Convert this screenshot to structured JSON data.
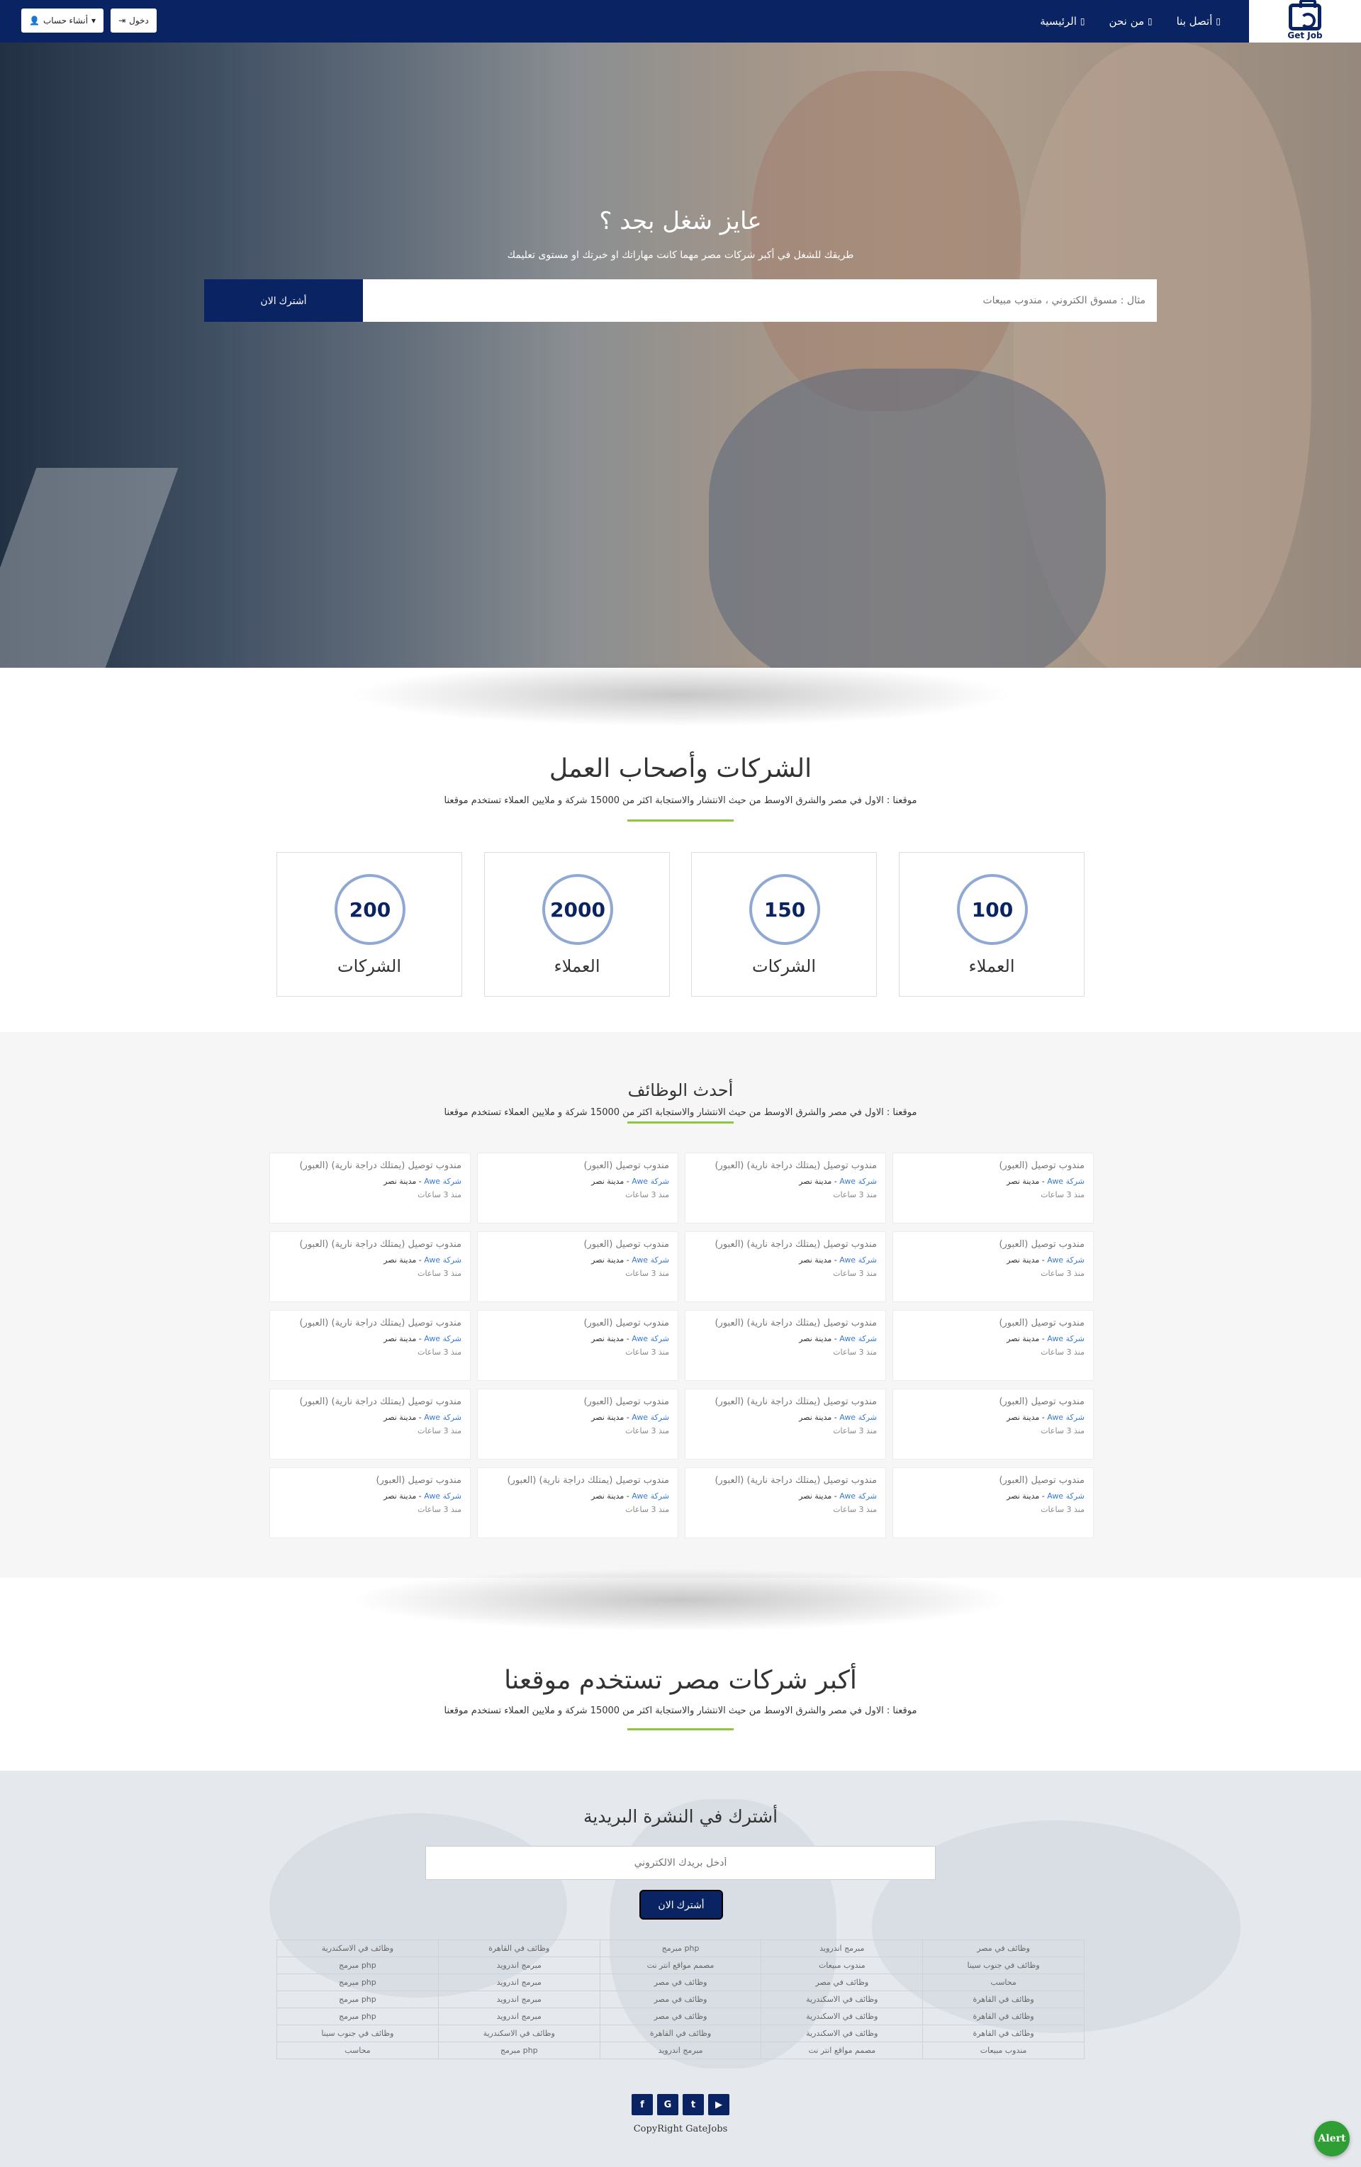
{
  "nav": {
    "logo_text": "Get Job",
    "links": [
      "الرئيسية",
      "من نحن",
      "أتصل بنا"
    ],
    "login": "دخول",
    "register": "أنشاء حساب"
  },
  "hero": {
    "title": "عايز شغل بجد ؟",
    "subtitle": "طريقك للشغل في أكبر شركات مصر مهما كانت مهاراتك او خبرتك او مستوى تعليمك",
    "search_placeholder": "مثال : مسوق الكتروني ، مندوب مبيعات",
    "search_button": "أشترك الان"
  },
  "companies": {
    "title": "الشركات وأصحاب العمل",
    "subtitle": "موقعنا : الاول في مصر والشرق الاوسط من حيث الانتشار والاستجابة اكثر من 15000 شركة و ملايين العملاء تستخدم موقعنا",
    "stats": [
      {
        "value": "100",
        "label": "العملاء"
      },
      {
        "value": "150",
        "label": "الشركات"
      },
      {
        "value": "2000",
        "label": "العملاء"
      },
      {
        "value": "200",
        "label": "الشركات"
      }
    ]
  },
  "jobs": {
    "title": "أحدث الوظائف",
    "subtitle": "موقعنا : الاول في مصر والشرق الاوسط من حيث الانتشار والاستجابة اكثر من 15000 شركة و ملايين العملاء تستخدم موقعنا",
    "company": "شركة Awe",
    "sep": " - ",
    "location": "مدينة نصر",
    "time": "منذ 3 ساعات",
    "rows": [
      [
        "مندوب توصيل (العبور)",
        "مندوب توصيل (يمتلك دراجة نارية) (العبور)",
        "مندوب توصيل (العبور)",
        "مندوب توصيل (يمتلك دراجة نارية) (العبور)"
      ],
      [
        "مندوب توصيل (العبور)",
        "مندوب توصيل (يمتلك دراجة نارية) (العبور)",
        "مندوب توصيل (العبور)",
        "مندوب توصيل (يمتلك دراجة نارية) (العبور)"
      ],
      [
        "مندوب توصيل (العبور)",
        "مندوب توصيل (يمتلك دراجة نارية) (العبور)",
        "مندوب توصيل (العبور)",
        "مندوب توصيل (يمتلك دراجة نارية) (العبور)"
      ],
      [
        "مندوب توصيل (العبور)",
        "مندوب توصيل (يمتلك دراجة نارية) (العبور)",
        "مندوب توصيل (العبور)",
        "مندوب توصيل (يمتلك دراجة نارية) (العبور)"
      ],
      [
        "مندوب توصيل (العبور)",
        "مندوب توصيل (يمتلك دراجة نارية) (العبور)",
        "مندوب توصيل (يمتلك دراجة نارية) (العبور)",
        "مندوب توصيل (العبور)"
      ]
    ]
  },
  "big_companies": {
    "title": "أكبر شركات مصر تستخدم موقعنا",
    "subtitle": "موقعنا : الاول في مصر والشرق الاوسط من حيث الانتشار والاستجابة اكثر من 15000 شركة و ملايين العملاء تستخدم موقعنا"
  },
  "newsletter": {
    "title": "أشترك في النشرة البريدية",
    "placeholder": "أدخل بريدك الالكتروني",
    "button": "أشترك الان"
  },
  "footer_links": [
    [
      "وظائف في مصر",
      "مبرمج اندرويد",
      "php مبرمج",
      "وظائف في القاهرة",
      "وظائف في الاسكندرية"
    ],
    [
      "وظائف في جنوب سينا",
      "مندوب مبيعات",
      "مصمم مواقع انتر نت",
      "مبرمج اندرويد",
      "php مبرمج"
    ],
    [
      "محاسب",
      "وظائف في مصر",
      "وظائف في مصر",
      "مبرمج اندرويد",
      "php مبرمج"
    ],
    [
      "وظائف في القاهرة",
      "وظائف في الاسكندرية",
      "وظائف في مصر",
      "مبرمج اندرويد",
      "php مبرمج"
    ],
    [
      "وظائف في القاهرة",
      "وظائف في الاسكندرية",
      "وظائف في مصر",
      "مبرمج اندرويد",
      "php مبرمج"
    ],
    [
      "وظائف في القاهرة",
      "وظائف في الاسكندرية",
      "وظائف في القاهرة",
      "وظائف في الاسكندرية",
      "وظائف في جنوب سينا"
    ],
    [
      "مندوب مبيعات",
      "مصمم مواقع انتر نت",
      "مبرمج اندرويد",
      "php مبرمج",
      "محاسب"
    ]
  ],
  "social": [
    "f",
    "G",
    "t",
    "▶"
  ],
  "copyright": "CopyRight  GateJobs",
  "alert": "Alert"
}
